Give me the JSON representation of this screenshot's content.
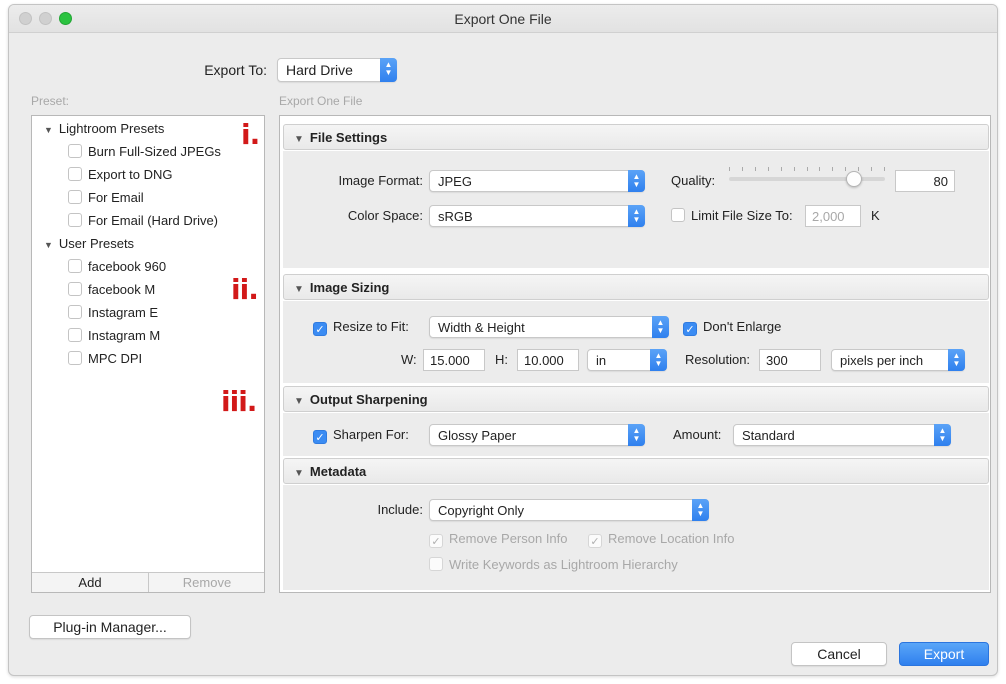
{
  "window": {
    "title": "Export One File"
  },
  "export_to": {
    "label": "Export To:",
    "value": "Hard Drive"
  },
  "preset": {
    "heading": "Preset:",
    "groups": [
      {
        "name": "Lightroom Presets",
        "items": [
          "Burn Full-Sized JPEGs",
          "Export to DNG",
          "For Email",
          "For Email (Hard Drive)"
        ]
      },
      {
        "name": "User Presets",
        "items": [
          "facebook 960",
          "facebook M",
          "Instagram E",
          "Instagram M",
          "MPC DPI"
        ]
      }
    ],
    "add_label": "Add",
    "remove_label": "Remove"
  },
  "main_heading": "Export One File",
  "annotations": [
    "i.",
    "ii.",
    "iii."
  ],
  "file_settings": {
    "title": "File Settings",
    "image_format_label": "Image Format:",
    "image_format": "JPEG",
    "quality_label": "Quality:",
    "quality": "80",
    "quality_fraction": 0.8,
    "color_space_label": "Color Space:",
    "color_space": "sRGB",
    "limit_label": "Limit File Size To:",
    "limit_value": "2,000",
    "limit_unit": "K",
    "limit_checked": false
  },
  "image_sizing": {
    "title": "Image Sizing",
    "resize_label": "Resize to Fit:",
    "resize_checked": true,
    "resize_mode": "Width & Height",
    "dont_enlarge_label": "Don't Enlarge",
    "dont_enlarge_checked": true,
    "w_label": "W:",
    "w_value": "15.000",
    "h_label": "H:",
    "h_value": "10.000",
    "unit": "in",
    "resolution_label": "Resolution:",
    "resolution_value": "300",
    "resolution_unit": "pixels per inch"
  },
  "output_sharpening": {
    "title": "Output Sharpening",
    "sharpen_label": "Sharpen For:",
    "sharpen_checked": true,
    "sharpen_for": "Glossy Paper",
    "amount_label": "Amount:",
    "amount": "Standard"
  },
  "metadata": {
    "title": "Metadata",
    "include_label": "Include:",
    "include_value": "Copyright Only",
    "remove_person_label": "Remove Person Info",
    "remove_location_label": "Remove Location Info",
    "write_keywords_label": "Write Keywords as Lightroom Hierarchy"
  },
  "buttons": {
    "plugin_manager": "Plug-in Manager...",
    "cancel": "Cancel",
    "export": "Export"
  },
  "colors": {
    "accent": "#2f80ee",
    "annotation": "#d21919",
    "zoom_green": "#2bc340"
  }
}
